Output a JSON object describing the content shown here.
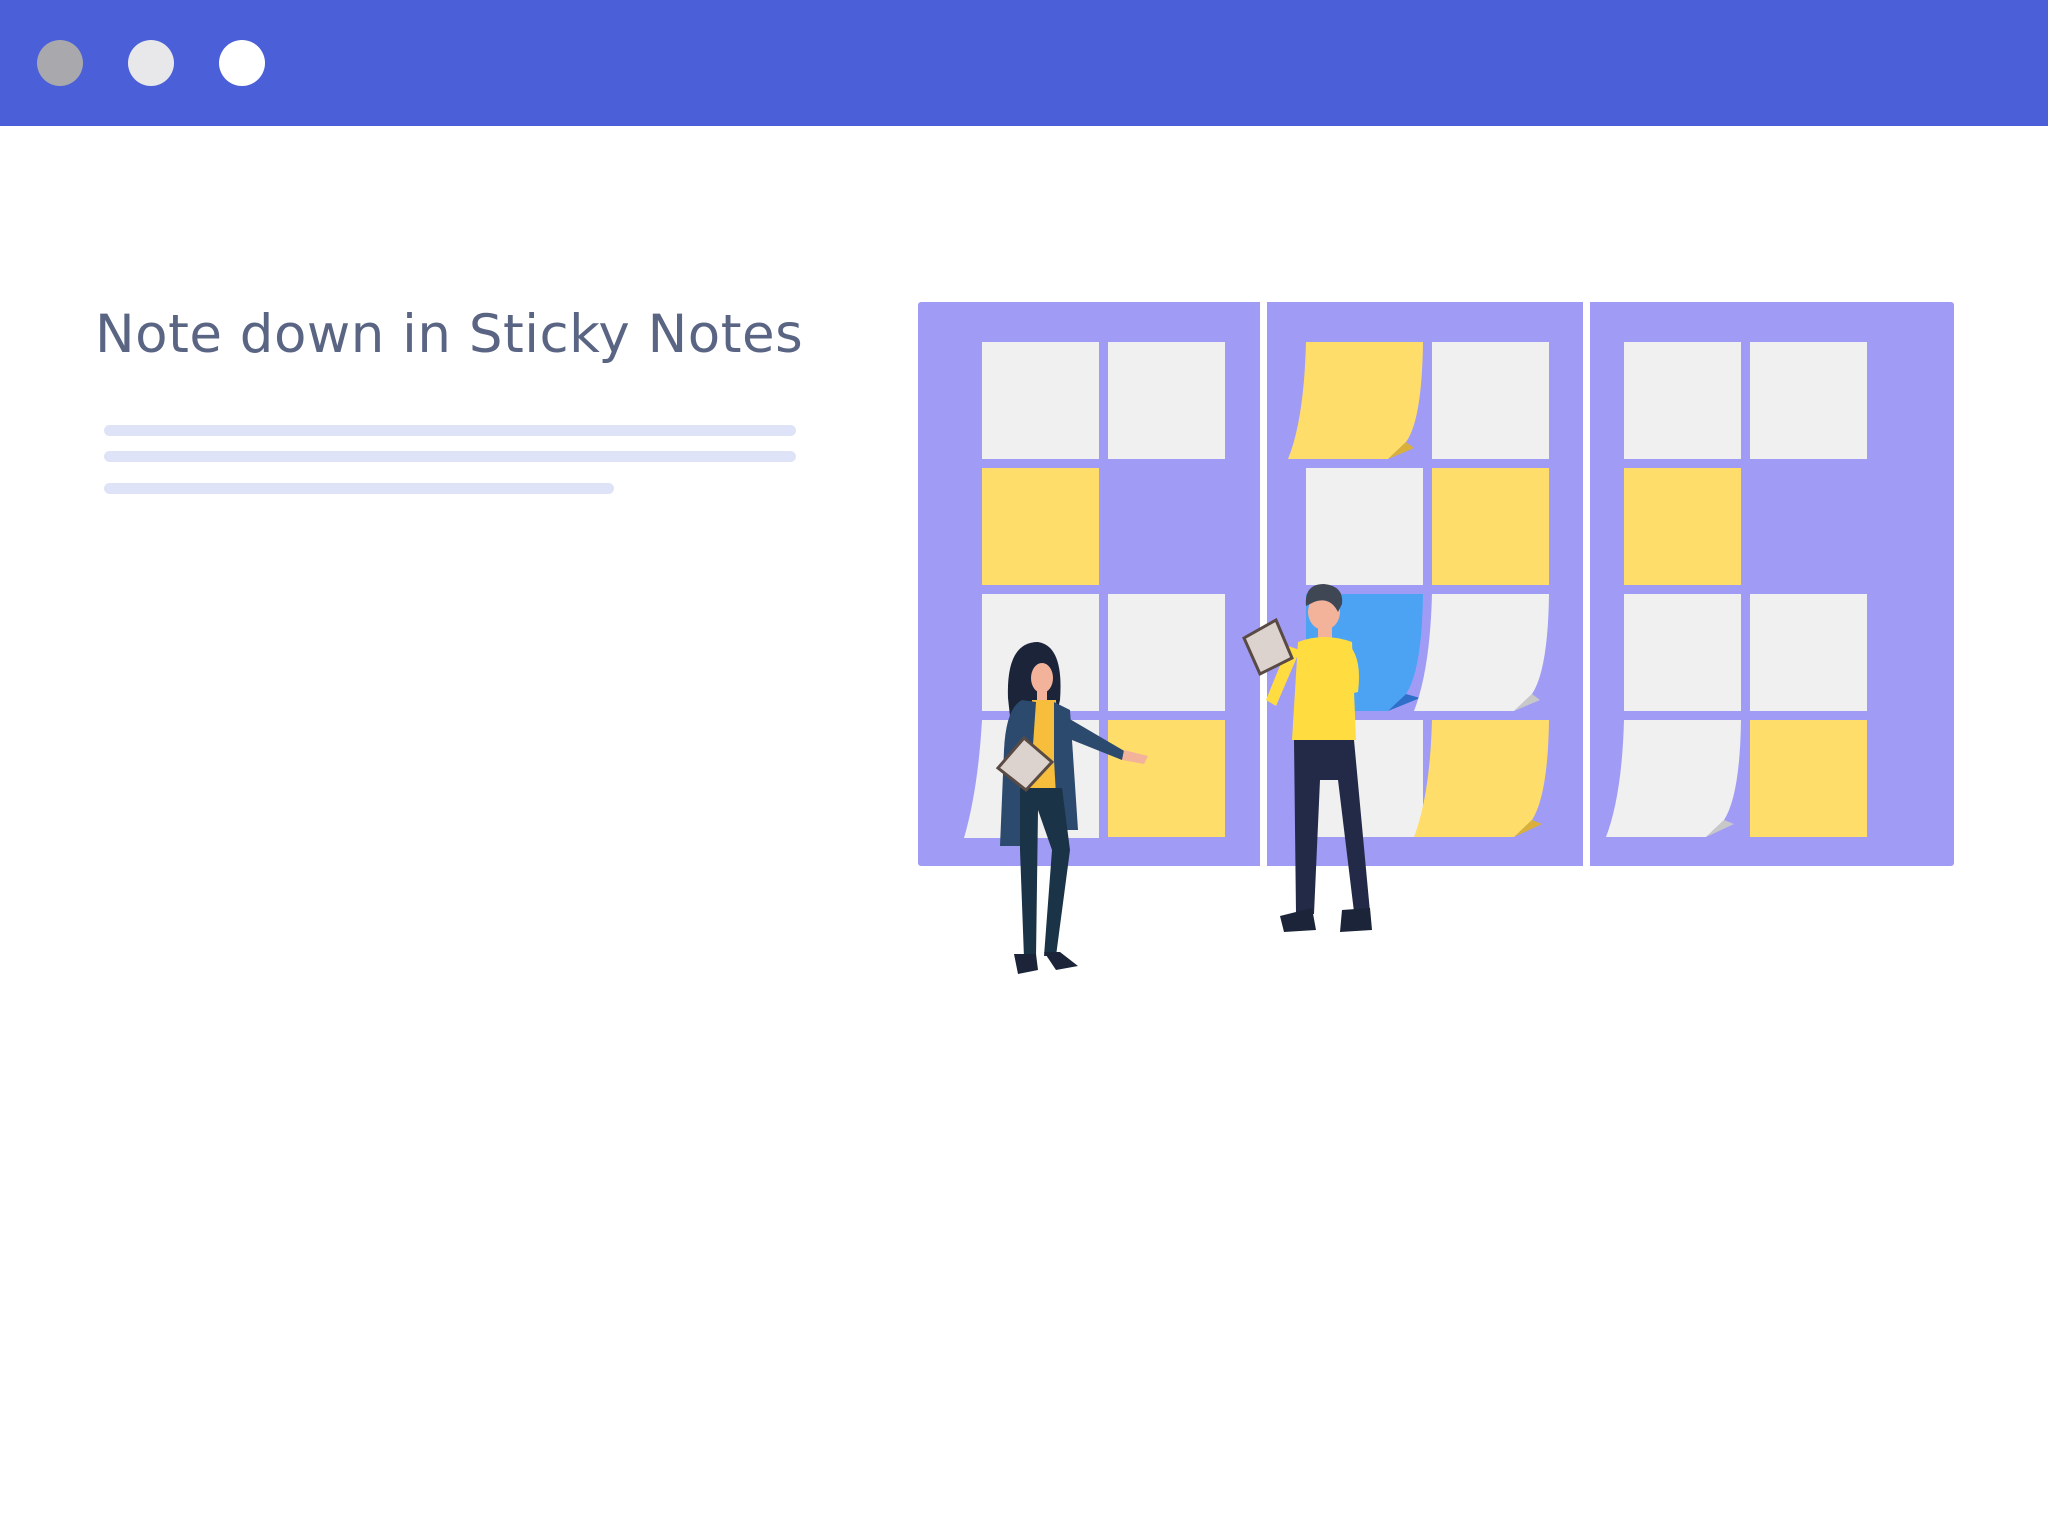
{
  "window": {
    "controls": [
      "close-dot",
      "minimize-dot",
      "maximize-dot"
    ],
    "titlebar_color": "#4a5fd8"
  },
  "content": {
    "heading": "Note down in Sticky Notes"
  },
  "colors": {
    "board": "#a09cf5",
    "note_white": "#f0f0f0",
    "note_yellow": "#ffdd6a",
    "note_blue": "#4ca3f3",
    "placeholder_line": "#dfe3f7",
    "heading_text": "#5a6584"
  }
}
